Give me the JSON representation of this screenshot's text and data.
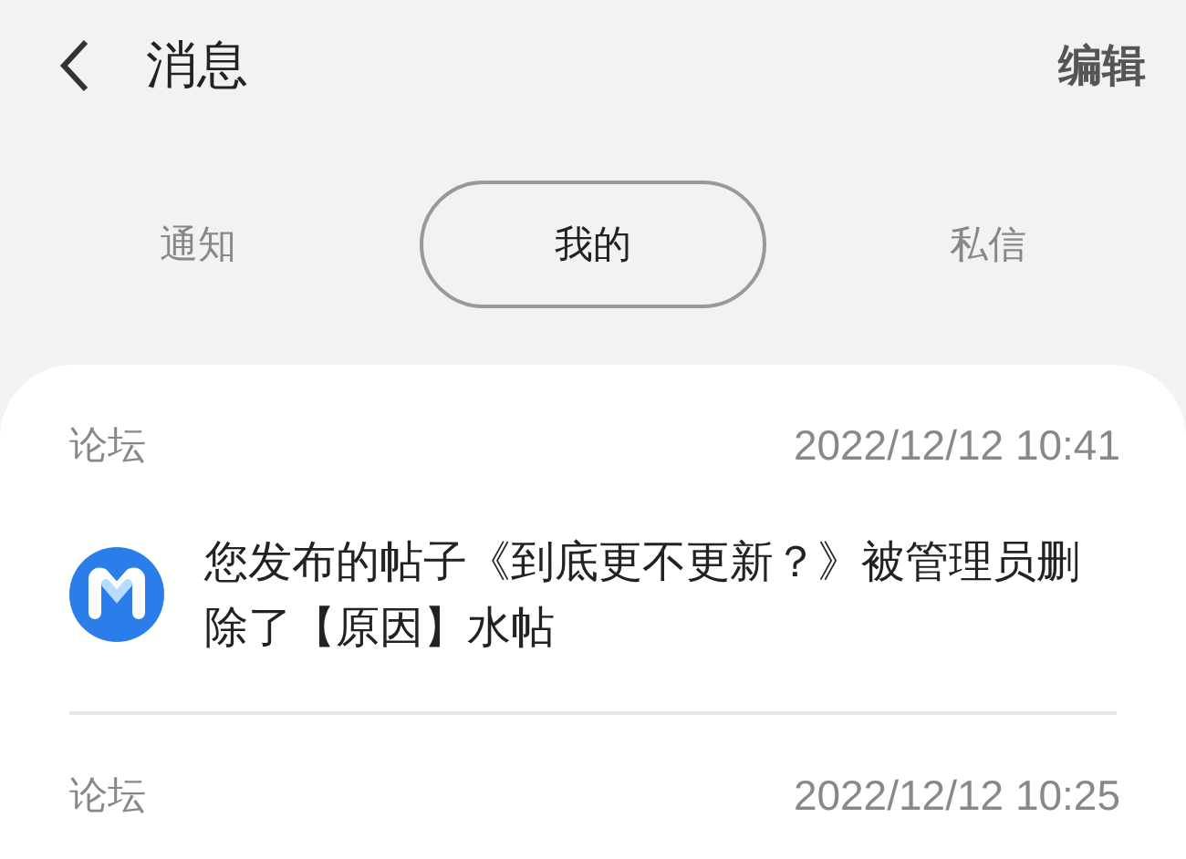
{
  "header": {
    "title": "消息",
    "action": "编辑"
  },
  "tabs": [
    {
      "label": "通知",
      "selected": false
    },
    {
      "label": "我的",
      "selected": true
    },
    {
      "label": "私信",
      "selected": false
    }
  ],
  "messages": [
    {
      "source": "论坛",
      "time": "2022/12/12 10:41",
      "text": "您发布的帖子《到底更不更新？》被管理员删除了【原因】水帖"
    },
    {
      "source": "论坛",
      "time": "2022/12/12 10:25"
    }
  ]
}
